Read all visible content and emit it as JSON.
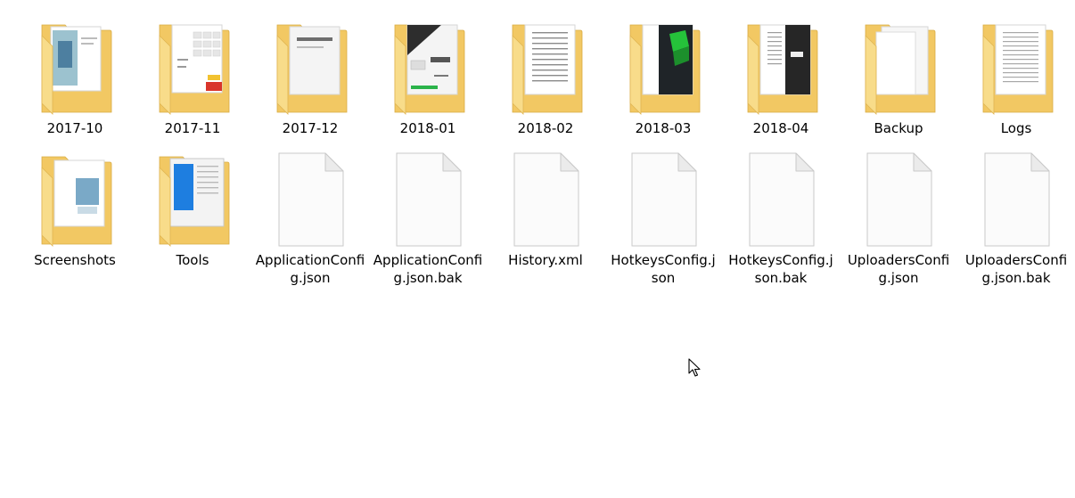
{
  "colors": {
    "folder_back": "#f2c863",
    "folder_front": "#f8dc8a",
    "file_page": "#fbfbfb",
    "file_border": "#c9c9c9"
  },
  "items": [
    {
      "name": "2017-10",
      "kind": "folder",
      "icon": "folder-with-preview-icon"
    },
    {
      "name": "2017-11",
      "kind": "folder",
      "icon": "folder-with-preview-icon"
    },
    {
      "name": "2017-12",
      "kind": "folder",
      "icon": "folder-with-preview-icon"
    },
    {
      "name": "2018-01",
      "kind": "folder",
      "icon": "folder-with-preview-icon"
    },
    {
      "name": "2018-02",
      "kind": "folder",
      "icon": "folder-with-preview-icon"
    },
    {
      "name": "2018-03",
      "kind": "folder",
      "icon": "folder-with-preview-icon"
    },
    {
      "name": "2018-04",
      "kind": "folder",
      "icon": "folder-with-preview-icon"
    },
    {
      "name": "Backup",
      "kind": "folder",
      "icon": "folder-with-preview-icon"
    },
    {
      "name": "Logs",
      "kind": "folder",
      "icon": "folder-with-preview-icon"
    },
    {
      "name": "Screenshots",
      "kind": "folder",
      "icon": "folder-with-preview-icon"
    },
    {
      "name": "Tools",
      "kind": "folder",
      "icon": "folder-with-preview-icon"
    },
    {
      "name": "ApplicationConfig.json",
      "kind": "file",
      "icon": "blank-file-icon"
    },
    {
      "name": "ApplicationConfig.json.bak",
      "kind": "file",
      "icon": "blank-file-icon"
    },
    {
      "name": "History.xml",
      "kind": "file",
      "icon": "blank-file-icon"
    },
    {
      "name": "HotkeysConfig.json",
      "kind": "file",
      "icon": "blank-file-icon"
    },
    {
      "name": "HotkeysConfig.json.bak",
      "kind": "file",
      "icon": "blank-file-icon"
    },
    {
      "name": "UploadersConfig.json",
      "kind": "file",
      "icon": "blank-file-icon"
    },
    {
      "name": "UploadersConfig.json.bak",
      "kind": "file",
      "icon": "blank-file-icon"
    }
  ]
}
